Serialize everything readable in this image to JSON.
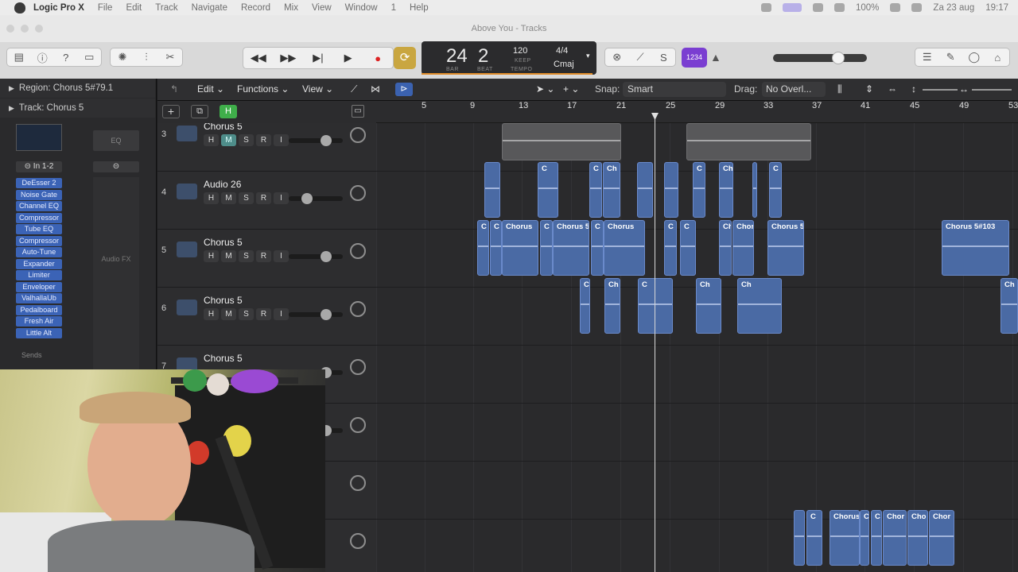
{
  "menubar": {
    "app": "Logic Pro X",
    "items": [
      "File",
      "Edit",
      "Track",
      "Navigate",
      "Record",
      "Mix",
      "View",
      "Window",
      "1",
      "Help"
    ],
    "battery": "100%",
    "date": "Za 23 aug",
    "time": "19:17"
  },
  "window": {
    "title": "Above You - Tracks"
  },
  "lcd": {
    "bar": "24",
    "beat": "2",
    "bar_label": "BAR",
    "beat_label": "BEAT",
    "tempo": "120",
    "keep": "KEEP",
    "tempo_label": "TEMPO",
    "signature": "4/4",
    "key": "Cmaj"
  },
  "control": {
    "count_in": "1234"
  },
  "inspector": {
    "region": "Region: Chorus 5#79.1",
    "track": "Track: Chorus 5",
    "input": "In 1-2",
    "eq": "EQ",
    "audio_fx": "Audio FX",
    "sends": "Sends",
    "plugins": [
      "DeEsser 2",
      "Noise Gate",
      "Channel EQ",
      "Compressor",
      "Tube EQ",
      "Compressor",
      "Auto-Tune",
      "Expander",
      "Limiter",
      "Enveloper",
      "ValhallaUb",
      "Pedalboard",
      "Fresh Air",
      "Little Alt"
    ]
  },
  "localbar": {
    "edit": "Edit",
    "functions": "Functions",
    "view": "View",
    "snap_label": "Snap:",
    "snap": "Smart",
    "drag_label": "Drag:",
    "drag": "No Overl..."
  },
  "ruler": {
    "bars": [
      "5",
      "9",
      "13",
      "17",
      "21",
      "25",
      "29",
      "33",
      "37",
      "41",
      "45",
      "49",
      "53"
    ]
  },
  "tracks": [
    {
      "num": "3",
      "name": "Chorus 5",
      "mute_on": true
    },
    {
      "num": "4",
      "name": "Audio 26",
      "mute_on": false
    },
    {
      "num": "5",
      "name": "Chorus 5",
      "mute_on": false
    },
    {
      "num": "6",
      "name": "Chorus 5",
      "mute_on": false
    },
    {
      "num": "7",
      "name": "Chorus 5",
      "mute_on": false
    }
  ],
  "track_buttons": [
    "H",
    "M",
    "S",
    "R",
    "I"
  ],
  "regions": {
    "r5_chorus": "Chorus",
    "r5_chorus5a": "Chorus 5",
    "r5_chorus5b": "Chorus",
    "r5_ch": "Ch",
    "r5_chor": "Chor",
    "r5_chorus5c": "Chorus 5",
    "r5_far": "Chorus 5#103",
    "r4_c": "C",
    "r4_ch": "Ch",
    "r10_chorus": "Chorus",
    "r10_chor": "Chor",
    "r10_cho": "Cho",
    "r10_chor2": "Chor"
  }
}
